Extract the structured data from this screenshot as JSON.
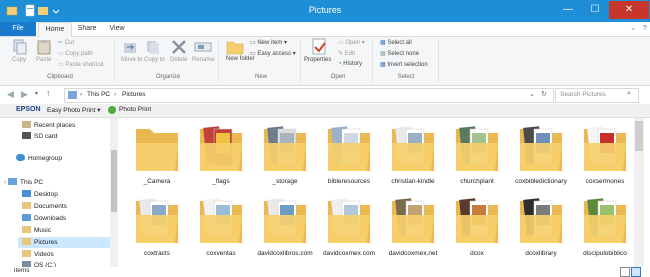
{
  "window": {
    "title": "Pictures",
    "minimize": "—",
    "maximize": "☐",
    "close": "✕"
  },
  "ribbon_tabs": [
    "File",
    "Home",
    "Share",
    "View"
  ],
  "ribbon": {
    "clipboard": {
      "copy": "Copy",
      "paste": "Paste",
      "cut": "Cut",
      "copy_path": "Copy path",
      "paste_shortcut": "Paste shortcut",
      "group": "Clipboard"
    },
    "organize": {
      "move_to": "Move to",
      "copy_to": "Copy to",
      "delete": "Delete",
      "rename": "Rename",
      "group": "Organize"
    },
    "new": {
      "new_folder": "New folder",
      "new_item": "New item ▾",
      "easy_access": "Easy access ▾",
      "group": "New"
    },
    "open": {
      "properties": "Properties",
      "open": "Open ▾",
      "edit": "Edit",
      "history": "History",
      "group": "Open"
    },
    "select": {
      "select_all": "Select all",
      "select_none": "Select none",
      "invert_selection": "Invert selection",
      "group": "Select"
    }
  },
  "address": {
    "crumb1": "This PC",
    "crumb2": "Pictures",
    "search_placeholder": "Search Pictures"
  },
  "epson": {
    "brand": "EPSON",
    "easy_photo_print": "Easy Photo Print ▾",
    "photo_print": "Photo Print"
  },
  "nav": {
    "recent_places": "Recent places",
    "sd_card": "SD card",
    "homegroup": "Homegroup",
    "this_pc": "This PC",
    "desktop": "Desktop",
    "documents": "Documents",
    "downloads": "Downloads",
    "music": "Music",
    "pictures": "Pictures",
    "videos": "Videos",
    "os_c": "OS (C:)"
  },
  "folders": [
    "_Camera",
    "_flags",
    "_storage",
    "bibleresources",
    "christian-kindle",
    "churchplant",
    "coxbibledictionary",
    "coxsermones",
    "coxtracts",
    "coxventas",
    "davidcoxlibros.com",
    "davidcoxmex.com",
    "davidcoxmex.net",
    "dcox",
    "dcoxlibrary",
    "discipulobiblico"
  ],
  "status": {
    "items": "items"
  },
  "colors": {
    "titlebar": "#1e8fd6",
    "file_tab": "#1979ca",
    "close": "#c7362b",
    "folder": "#f6cf6c"
  }
}
